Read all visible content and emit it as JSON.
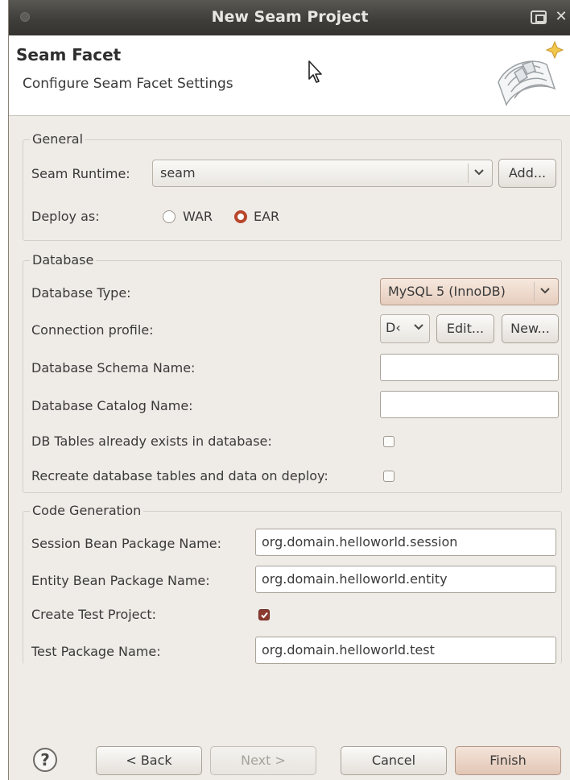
{
  "window": {
    "title": "New Seam Project"
  },
  "header": {
    "title": "Seam Facet",
    "subtitle": "Configure Seam Facet Settings"
  },
  "general": {
    "group_title": "General",
    "runtime_label": "Seam Runtime:",
    "runtime_value": "seam",
    "add_label": "Add...",
    "deploy_label": "Deploy as:",
    "deploy_options": [
      "WAR",
      "EAR"
    ],
    "deploy_selected": "EAR"
  },
  "database": {
    "group_title": "Database",
    "type_label": "Database Type:",
    "type_value": "MySQL 5 (InnoDB)",
    "profile_label": "Connection profile:",
    "profile_value": "D‹",
    "edit_label": "Edit...",
    "new_label": "New...",
    "schema_label": "Database Schema Name:",
    "schema_value": "",
    "catalog_label": "Database Catalog Name:",
    "catalog_value": "",
    "tables_exist_label": "DB Tables already exists in database:",
    "tables_exist_checked": false,
    "recreate_label": "Recreate database tables and data on deploy:",
    "recreate_checked": false
  },
  "code_generation": {
    "group_title": "Code Generation",
    "session_label": "Session Bean Package Name:",
    "session_value": "org.domain.helloworld.session",
    "entity_label": "Entity Bean Package Name:",
    "entity_value": "org.domain.helloworld.entity",
    "test_project_label": "Create Test Project:",
    "test_project_checked": true,
    "test_package_label": "Test Package Name:",
    "test_package_value": "org.domain.helloworld.test"
  },
  "buttons": {
    "help": "?",
    "back": "< Back",
    "next": "Next >",
    "cancel": "Cancel",
    "finish": "Finish"
  },
  "colors": {
    "radio_selected": "#b8462d",
    "checkbox_checked": "#8b3a2f",
    "default_button": "#e2c6b5",
    "titlebar": "#3f3e3a"
  },
  "icons": {
    "help": "help-icon",
    "wizard": "seam-wizard-graphic",
    "cursor": "mouse-pointer-icon"
  }
}
